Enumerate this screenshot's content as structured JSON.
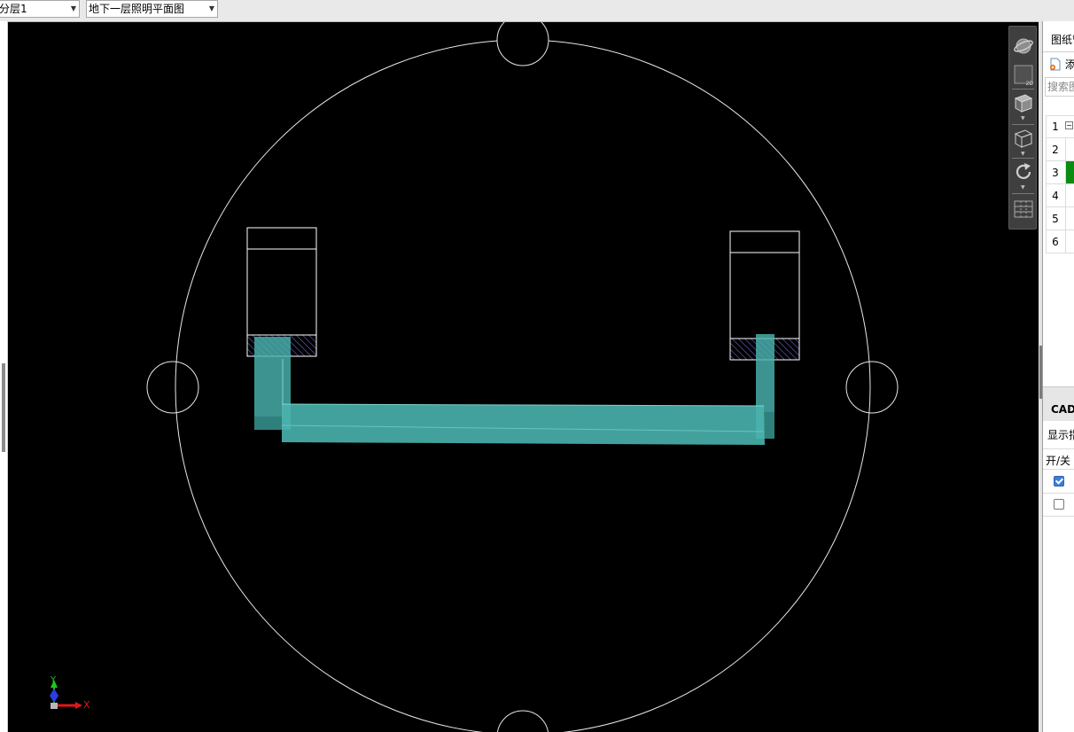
{
  "toolbar": {
    "layer_select": {
      "value": "分层1"
    },
    "drawing_select": {
      "value": "地下一层照明平面图"
    }
  },
  "viewport": {
    "axis": {
      "x_label": "X",
      "y_label": "Y"
    }
  },
  "view_toolbar": {
    "items": [
      {
        "icon": "orbit-icon"
      },
      {
        "icon": "2d-view-icon",
        "tag": "2D"
      },
      {
        "icon": "iso-cube-view-icon"
      },
      {
        "icon": "wireframe-cube-icon"
      },
      {
        "icon": "rotate-icon"
      },
      {
        "icon": "grid-layout-icon"
      }
    ]
  },
  "right_panel": {
    "header_tab": "图纸管",
    "add_label": "添",
    "search_placeholder": "搜索图",
    "rows": [
      {
        "num": "1"
      },
      {
        "num": "2"
      },
      {
        "num": "3",
        "selected": true,
        "color": "#0a8c10"
      },
      {
        "num": "4"
      },
      {
        "num": "5"
      },
      {
        "num": "6"
      }
    ],
    "cad_section": {
      "title": "CAD",
      "subtitle": "显示指",
      "column_header": "开/关",
      "toggles": [
        {
          "checked": true
        },
        {
          "checked": false
        }
      ]
    }
  },
  "colors": {
    "background": "#000000",
    "linework": "#ffffff",
    "conduit": "#4ab3ae",
    "hatch": "#6a62c8",
    "selected_row": "#0a8c10"
  }
}
